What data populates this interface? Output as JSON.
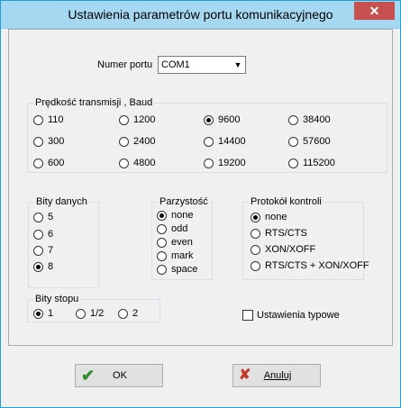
{
  "title": "Ustawienia parametrów portu komunikacyjnego",
  "port": {
    "label": "Numer portu",
    "value": "COM1"
  },
  "baud": {
    "title": "Prędkość transmisji , Baud",
    "options": [
      "110",
      "1200",
      "9600",
      "38400",
      "300",
      "2400",
      "14400",
      "57600",
      "600",
      "4800",
      "19200",
      "115200"
    ],
    "selected": "9600"
  },
  "data_bits": {
    "title": "Bity danych",
    "options": [
      "5",
      "6",
      "7",
      "8"
    ],
    "selected": "8"
  },
  "parity": {
    "title": "Parzystość",
    "options": [
      "none",
      "odd",
      "even",
      "mark",
      "space"
    ],
    "selected": "none"
  },
  "protocol": {
    "title": "Protokół kontroli",
    "options": [
      "none",
      "RTS/CTS",
      "XON/XOFF",
      "RTS/CTS + XON/XOFF"
    ],
    "selected": "none"
  },
  "stop_bits": {
    "title": "Bity stopu",
    "options": [
      "1",
      "1/2",
      "2"
    ],
    "selected": "1"
  },
  "defaults": {
    "label": "Ustawienia typowe",
    "checked": false
  },
  "buttons": {
    "ok": "OK",
    "cancel": "Anuluj"
  },
  "colors": {
    "title_bar": "#a6d9f1",
    "close": "#c75050",
    "ok_icon": "#2e8b2e",
    "cancel_icon": "#c0392b"
  },
  "icons": {
    "close": "close-icon",
    "ok": "checkmark-icon",
    "cancel": "x-mark-icon",
    "dropdown": "chevron-down-icon"
  }
}
